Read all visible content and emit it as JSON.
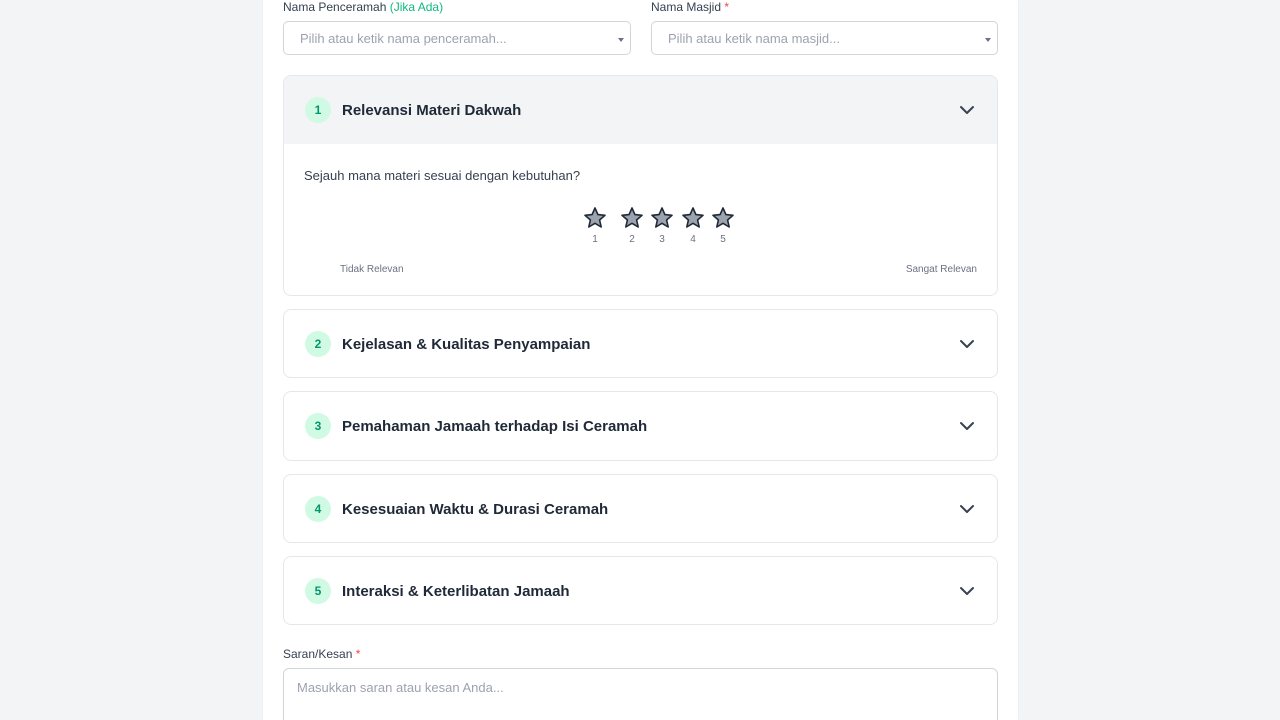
{
  "form": {
    "speaker": {
      "label": "Nama Penceramah",
      "hint": "(Jika Ada)",
      "placeholder": "Pilih atau ketik nama penceramah..."
    },
    "mosque": {
      "label": "Nama Masjid",
      "required": "*",
      "placeholder": "Pilih atau ketik nama masjid..."
    },
    "sections": [
      {
        "number": "1",
        "title": "Relevansi Materi Dakwah",
        "question": "Sejauh mana materi sesuai dengan kebutuhan?",
        "low_label": "Tidak Relevan",
        "high_label": "Sangat Relevan"
      },
      {
        "number": "2",
        "title": "Kejelasan & Kualitas Penyampaian"
      },
      {
        "number": "3",
        "title": "Pemahaman Jamaah terhadap Isi Ceramah"
      },
      {
        "number": "4",
        "title": "Kesesuaian Waktu & Durasi Ceramah"
      },
      {
        "number": "5",
        "title": "Interaksi & Keterlibatan Jamaah"
      }
    ],
    "stars": [
      "1",
      "2",
      "3",
      "4",
      "5"
    ],
    "suggestion": {
      "label": "Saran/Kesan",
      "required": "*",
      "placeholder": "Masukkan saran atau kesan Anda..."
    }
  },
  "colors": {
    "accent": "#10b981",
    "accent_bg": "#d1fae5",
    "star_fill": "#9ca3af",
    "required": "#ef4444"
  },
  "icons": {
    "chevron": "chevron-down-icon",
    "star": "star-icon",
    "caret": "caret-down-icon"
  }
}
